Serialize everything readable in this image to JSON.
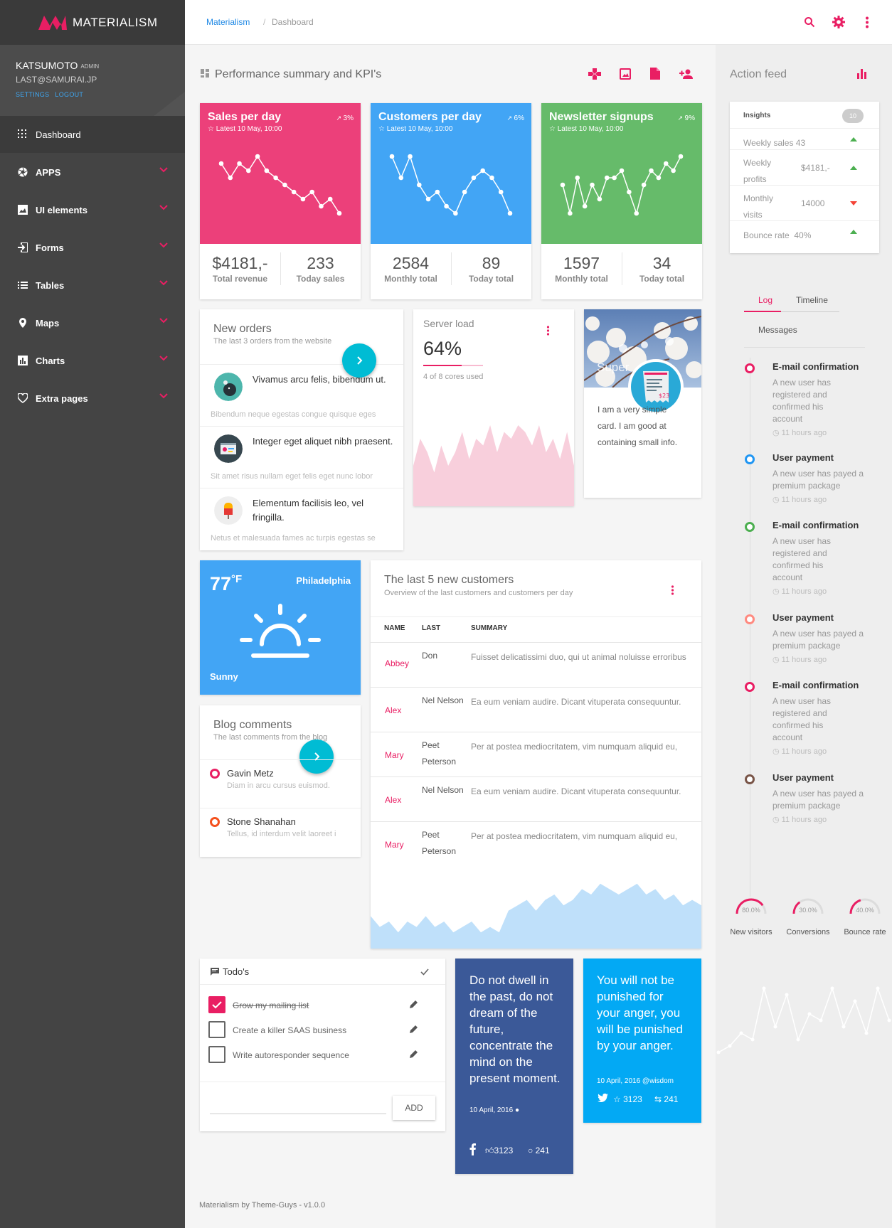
{
  "app": {
    "name": "MATERIALISM",
    "footer": "Materialism by Theme-Guys - v1.0.0"
  },
  "user": {
    "name": "KATSUMOTO",
    "role": "ADMIN",
    "email": "LAST@SAMURAI.JP",
    "settings": "SETTINGS",
    "logout": "LOGOUT"
  },
  "nav": [
    {
      "label": "Dashboard",
      "icon": "grid-icon",
      "active": true
    },
    {
      "label": "APPS",
      "icon": "aperture-icon"
    },
    {
      "label": "UI elements",
      "icon": "image-icon"
    },
    {
      "label": "Forms",
      "icon": "input-icon"
    },
    {
      "label": "Tables",
      "icon": "list-icon"
    },
    {
      "label": "Maps",
      "icon": "map-pin-icon"
    },
    {
      "label": "Charts",
      "icon": "bar-chart-icon"
    },
    {
      "label": "Extra pages",
      "icon": "heart-icon"
    }
  ],
  "breadcrumb": {
    "root": "Materialism",
    "separator": "/",
    "current": "Dashboard"
  },
  "colors": {
    "accent": "#e91e63",
    "pink": "#ec407a",
    "blue": "#42a5f5",
    "green": "#66bb6a",
    "teal": "#00bcd4",
    "facebook": "#3b5998",
    "twitter": "#03a9f4"
  },
  "main": {
    "title": "Performance summary and KPI's"
  },
  "kpis": [
    {
      "title": "Sales per day",
      "sub": "Latest 10 May, 10:00",
      "pct": "3%",
      "n1": "$4181,-",
      "l1": "Total revenue",
      "n2": "233",
      "l2": "Today sales"
    },
    {
      "title": "Customers per day",
      "sub": "Latest 10 May, 10:00",
      "pct": "6%",
      "n1": "2584",
      "l1": "Monthly total",
      "n2": "89",
      "l2": "Today total"
    },
    {
      "title": "Newsletter signups",
      "sub": "Latest 10 May, 10:00",
      "pct": "9%",
      "n1": "1597",
      "l1": "Monthly total",
      "n2": "34",
      "l2": "Today total"
    }
  ],
  "orders": {
    "title": "New orders",
    "subtitle": "The last 3 orders from the website",
    "items": [
      {
        "title": "Vivamus arcu felis, bibendum ut.",
        "desc": "Bibendum neque egestas congue quisque eges"
      },
      {
        "title": "Integer eget aliquet nibh praesent.",
        "desc": "Sit amet risus nullam eget felis eget nunc lobor"
      },
      {
        "title": "Elementum facilisis leo, vel fringilla.",
        "desc": "Netus et malesuada fames ac turpis egestas se"
      }
    ]
  },
  "server": {
    "title": "Server load",
    "value": "64%",
    "progress": 0.64,
    "note": "4 of 8 cores used"
  },
  "super_card": {
    "overlay": "Super",
    "receipt_amount": "$23",
    "text": "I am a very simple card. I am good at containing small info."
  },
  "weather": {
    "temp": "77",
    "unit": "°F",
    "city": "Philadelphia",
    "cond": "Sunny"
  },
  "blog": {
    "title": "Blog comments",
    "subtitle": "The last comments from the blog",
    "items": [
      {
        "name": "Gavin Metz",
        "text": "Diam in arcu cursus euismod."
      },
      {
        "name": "Stone Shanahan",
        "text": "Tellus, id interdum velit laoreet i"
      }
    ]
  },
  "customers": {
    "title": "The last 5 new customers",
    "subtitle": "Overview of the last customers and customers per day",
    "headers": [
      "NAME",
      "LAST",
      "SUMMARY"
    ],
    "rows": [
      {
        "name": "Abbey",
        "last": "Don",
        "summary": "Fuisset delicatissimi duo, qui ut animal noluisse erroribus"
      },
      {
        "name": "Alex",
        "last": "Nel Nelson",
        "summary": "Ea eum veniam audire. Dicant vituperata consequuntur."
      },
      {
        "name": "Mary",
        "last": "Peet Peterson",
        "summary": "Per at postea mediocritatem, vim numquam aliquid eu,"
      },
      {
        "name": "Alex",
        "last": "Nel Nelson",
        "summary": "Ea eum veniam audire. Dicant vituperata consequuntur."
      },
      {
        "name": "Mary",
        "last": "Peet Peterson",
        "summary": "Per at postea mediocritatem, vim numquam aliquid eu,"
      }
    ]
  },
  "todos": {
    "title": "Todo's",
    "add": "ADD",
    "items": [
      {
        "text": "Grow my mailing list",
        "done": true
      },
      {
        "text": "Create a killer SAAS business",
        "done": false
      },
      {
        "text": "Write autoresponder sequence",
        "done": false
      }
    ]
  },
  "fb_quote": {
    "text": "Do not dwell in the past, do not dream of the future, concentrate the mind on the present moment.",
    "date": "10 April, 2016",
    "likes": "3123",
    "comments": "241"
  },
  "tw_quote": {
    "text": "You will not be punished for your anger, you will be punished by your anger.",
    "meta": "10 April, 2016 @wisdom",
    "stars": "3123",
    "retweets": "241"
  },
  "feed": {
    "title": "Action feed",
    "insights": {
      "title": "Insights",
      "count": "10",
      "rows": [
        {
          "label": "Weekly sales 43",
          "value": "",
          "trend": "up"
        },
        {
          "label": "Weekly profits",
          "value": "$4181,-",
          "trend": "up"
        },
        {
          "label": "Monthly visits",
          "value": "14000",
          "trend": "down"
        },
        {
          "label": "Bounce rate  40%",
          "value": "",
          "trend": "up"
        }
      ]
    },
    "tabs": [
      "Log",
      "Timeline",
      "Messages"
    ],
    "events": [
      {
        "title": "E-mail confirmation",
        "text": "A new user has registered and confirmed his account",
        "time": "11 hours ago",
        "color": "#e91e63"
      },
      {
        "title": "User payment",
        "text": "A new user has payed a premium package",
        "time": "11 hours ago",
        "color": "#2196f3"
      },
      {
        "title": "E-mail confirmation",
        "text": "A new user has registered and confirmed his account",
        "time": "11 hours ago",
        "color": "#4caf50"
      },
      {
        "title": "User payment",
        "text": "A new user has payed a premium package",
        "time": "11 hours ago",
        "color": "#ff8a80"
      },
      {
        "title": "E-mail confirmation",
        "text": "A new user has registered and confirmed his account",
        "time": "11 hours ago",
        "color": "#e91e63"
      },
      {
        "title": "User payment",
        "text": "A new user has payed a premium package",
        "time": "11 hours ago",
        "color": "#795548"
      }
    ],
    "gauges": [
      {
        "value": "80.0%",
        "pct": 0.8,
        "label": "New visitors"
      },
      {
        "value": "30.0%",
        "pct": 0.3,
        "label": "Conversions"
      },
      {
        "value": "40.0%",
        "pct": 0.4,
        "label": "Bounce rate"
      }
    ]
  },
  "chart_data": [
    {
      "type": "line",
      "title": "Sales per day",
      "x": [
        1,
        2,
        3,
        4,
        5,
        6,
        7,
        8,
        9,
        10,
        11,
        12,
        13,
        14
      ],
      "values": [
        9,
        7,
        9,
        8,
        10,
        8,
        7,
        6,
        5,
        4,
        5,
        3,
        4,
        2
      ]
    },
    {
      "type": "line",
      "title": "Customers per day",
      "x": [
        1,
        2,
        3,
        4,
        5,
        6,
        7,
        8,
        9,
        10,
        11,
        12,
        13,
        14
      ],
      "values": [
        10,
        7,
        10,
        6,
        4,
        5,
        3,
        2,
        5,
        7,
        8,
        7,
        5,
        2
      ]
    },
    {
      "type": "line",
      "title": "Newsletter signups",
      "x": [
        1,
        2,
        3,
        4,
        5,
        6,
        7,
        8,
        9,
        10,
        11,
        12,
        13,
        14,
        15,
        16,
        17
      ],
      "values": [
        6,
        2,
        7,
        3,
        6,
        4,
        7,
        7,
        8,
        5,
        2,
        6,
        8,
        7,
        9,
        8,
        10
      ]
    },
    {
      "type": "area",
      "title": "Server load",
      "values": [
        6,
        10,
        8,
        5,
        9,
        6,
        8,
        11,
        7,
        10,
        9,
        12,
        8,
        11,
        10,
        12,
        11,
        9,
        12,
        8,
        10,
        7,
        11,
        6
      ]
    },
    {
      "type": "area",
      "title": "The last 5 new customers",
      "values": [
        6,
        4,
        5,
        3,
        5,
        4,
        6,
        4,
        5,
        3,
        4,
        5,
        3,
        4,
        3,
        7,
        8,
        9,
        7,
        9,
        10,
        8,
        9,
        11,
        10,
        12,
        11,
        10,
        11,
        12,
        10,
        11,
        9,
        10,
        8,
        9,
        8
      ]
    },
    {
      "type": "line",
      "title": "Action feed",
      "values": [
        2,
        3,
        5,
        4,
        12,
        6,
        11,
        4,
        8,
        7,
        12,
        6,
        10,
        5,
        12,
        7
      ]
    }
  ]
}
